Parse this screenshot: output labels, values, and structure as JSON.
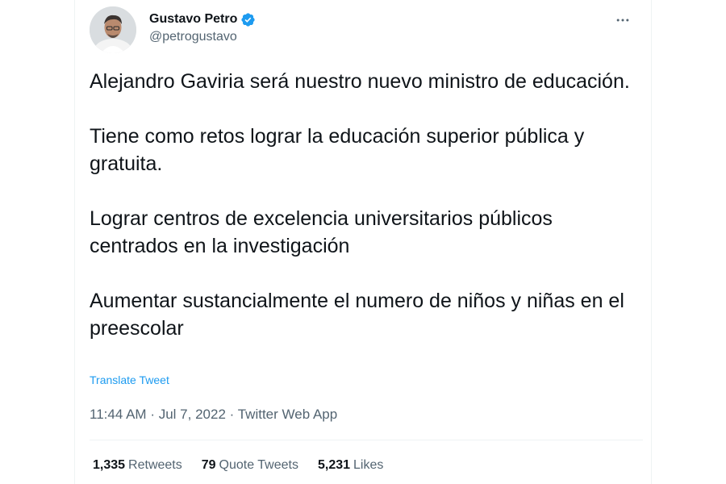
{
  "author": {
    "display_name": "Gustavo Petro",
    "handle": "@petrogustavo",
    "verified": true
  },
  "icons": {
    "verified": "verified-badge-icon",
    "more": "more-options-icon"
  },
  "colors": {
    "accent": "#1d9bf0",
    "text": "#0f1419",
    "muted": "#536471"
  },
  "tweet": {
    "paragraphs": [
      "Alejandro Gaviria será nuestro nuevo ministro de educación.",
      "Tiene como retos lograr la educación superior pública y gratuita.",
      "Lograr centros de excelencia universitarios públicos centrados en la investigación",
      "Aumentar sustancialmente el numero de niños y niñas en el preescolar"
    ],
    "translate_label": "Translate Tweet",
    "time": "11:44 AM",
    "date": "Jul 7, 2022",
    "source": "Twitter Web App",
    "separator": "·"
  },
  "stats": {
    "retweets": {
      "count": "1,335",
      "label": "Retweets"
    },
    "quote_tweets": {
      "count": "79",
      "label": "Quote Tweets"
    },
    "likes": {
      "count": "5,231",
      "label": "Likes"
    }
  }
}
